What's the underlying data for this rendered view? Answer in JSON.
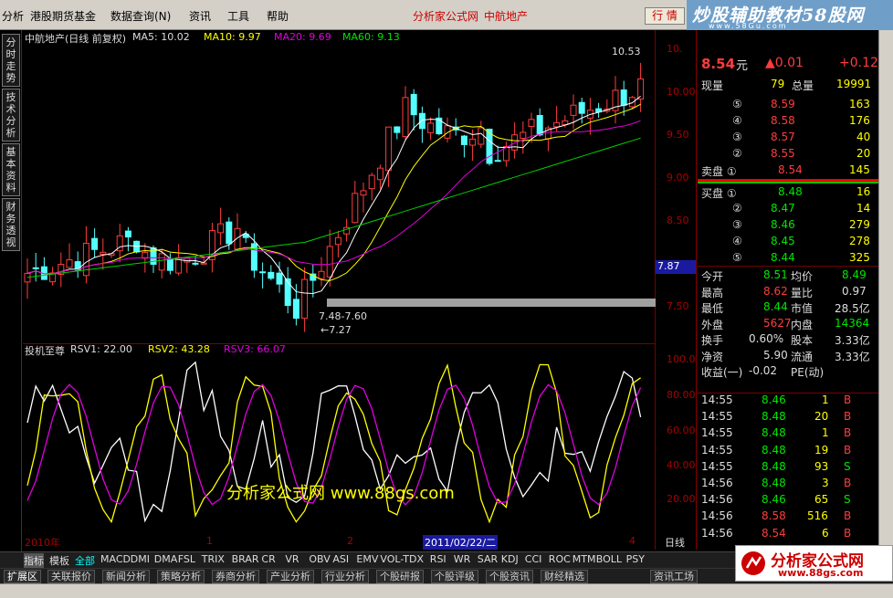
{
  "menu": {
    "items": [
      "分析",
      "港股期货基金",
      "数据查询(N)",
      "资讯",
      "工具",
      "帮助"
    ],
    "site": "分析家公式网",
    "stock_title": "中航地产",
    "quote_tab": "行 情"
  },
  "watermark_top": {
    "line1": "炒股辅助教材58股网",
    "line2": "www.58Gu.com"
  },
  "side_tabs": [
    "分时走势",
    "技术分析",
    "基本资料",
    "财务透视"
  ],
  "chart": {
    "title": "中航地产(日线 前复权)",
    "ma5": "MA5: 10.02",
    "ma10": "MA10: 9.97",
    "ma20": "MA20: 9.69",
    "ma60": "MA60: 9.13",
    "high_label": "10.53",
    "low_range": "7.48-7.60",
    "low_label": "←7.27",
    "price_tag": "7.87",
    "y_ticks": [
      "10.",
      "10.00",
      "9.50",
      "9.00",
      "8.50",
      "8.00",
      "7.50"
    ],
    "colors": {
      "ma5": "#ffffff",
      "ma10": "#ffff00",
      "ma20": "#e000e0",
      "ma60": "#00d000",
      "up": "#ff3c3c",
      "down": "#54ffff"
    }
  },
  "indicator": {
    "name": "投机至尊",
    "rsv1": "RSV1: 22.00",
    "rsv2": "RSV2: 43.28",
    "rsv3": "RSV3: 66.07",
    "y_ticks": [
      "100.0",
      "80.00",
      "60.00",
      "40.00",
      "20.00"
    ]
  },
  "x_axis": {
    "year": "2010年",
    "m1": "1",
    "m2": "2",
    "date": "2011/02/22/二",
    "m4": "4",
    "period": "日线"
  },
  "right_panel": {
    "price": "8.54",
    "price_unit": "元",
    "change": "▲0.01",
    "change_pct": "+0.12",
    "xianliang_label": "现量",
    "xianliang": "79",
    "zongliang_label": "总量",
    "zongliang": "19991",
    "sell": [
      {
        "lvl": "⑤",
        "p": "8.59",
        "v": "163"
      },
      {
        "lvl": "④",
        "p": "8.58",
        "v": "176"
      },
      {
        "lvl": "③",
        "p": "8.57",
        "v": "40"
      },
      {
        "lvl": "②",
        "p": "8.55",
        "v": "20"
      },
      {
        "lvl": "卖盘 ①",
        "p": "8.54",
        "v": "145"
      }
    ],
    "buy": [
      {
        "lvl": "买盘 ①",
        "p": "8.48",
        "v": "16"
      },
      {
        "lvl": "②",
        "p": "8.47",
        "v": "14"
      },
      {
        "lvl": "③",
        "p": "8.46",
        "v": "279"
      },
      {
        "lvl": "④",
        "p": "8.45",
        "v": "278"
      },
      {
        "lvl": "⑤",
        "p": "8.44",
        "v": "325"
      }
    ],
    "stats": [
      [
        "今开",
        "8.51",
        "均价",
        "8.49"
      ],
      [
        "最高",
        "8.62",
        "量比",
        "0.97"
      ],
      [
        "最低",
        "8.44",
        "市值",
        "28.5亿"
      ],
      [
        "外盘",
        "5627",
        "内盘",
        "14364"
      ],
      [
        "换手",
        "0.60%",
        "股本",
        "3.33亿"
      ],
      [
        "净资",
        "5.90",
        "流通",
        "3.33亿"
      ],
      [
        "收益(一)",
        "-0.02",
        "PE(动)",
        ""
      ]
    ],
    "ticks": [
      [
        "14:55",
        "8.46",
        "1",
        "B"
      ],
      [
        "14:55",
        "8.48",
        "20",
        "B"
      ],
      [
        "14:55",
        "8.48",
        "1",
        "B"
      ],
      [
        "14:55",
        "8.48",
        "19",
        "B"
      ],
      [
        "14:55",
        "8.48",
        "93",
        "S"
      ],
      [
        "14:56",
        "8.48",
        "3",
        "B"
      ],
      [
        "14:56",
        "8.46",
        "65",
        "S"
      ],
      [
        "14:56",
        "8.58",
        "516",
        "B"
      ],
      [
        "14:56",
        "8.54",
        "6",
        "B"
      ]
    ]
  },
  "bottom_tabs": [
    "指标",
    "模板",
    "全部",
    "MACD",
    "DMI",
    "DMA",
    "FSL",
    "TRIX",
    "BRAR",
    "CR",
    "VR",
    "OBV",
    "ASI",
    "EMV",
    "VOL-TDX",
    "RSI",
    "WR",
    "SAR",
    "KDJ",
    "CCI",
    "ROC",
    "MTM",
    "BOLL",
    "PSY"
  ],
  "bottom_tabs2": [
    "扩展区",
    "关联报价",
    "新闻分析",
    "策略分析",
    "券商分析",
    "产业分析",
    "行业分析",
    "个股研报",
    "个股评级",
    "个股资讯",
    "财经精选"
  ],
  "bottom_right": "资讯工场",
  "watermark_mid": "分析家公式网 www.88gs.com",
  "watermark_br": {
    "t1": "分析家公式网",
    "t2": "www.88gs.com"
  }
}
